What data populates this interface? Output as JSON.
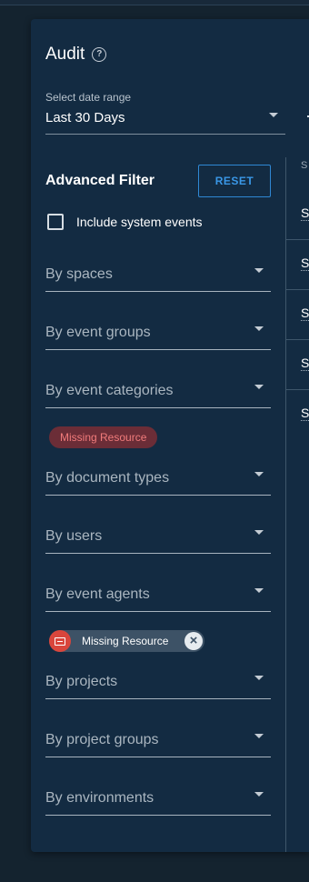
{
  "header": {
    "title": "Audit",
    "help_icon": "?"
  },
  "date_range": {
    "label": "Select date range",
    "value": "Last 30 Days"
  },
  "table": {
    "column_header": "S",
    "rows": [
      "S",
      "S",
      "S",
      "S",
      "S"
    ]
  },
  "advanced_filter": {
    "title": "Advanced Filter",
    "reset_label": "RESET",
    "include_system_events_label": "Include system events",
    "include_system_events_checked": false,
    "fields": {
      "spaces": "By spaces",
      "event_groups": "By event groups",
      "event_categories": "By event categories",
      "document_types": "By document types",
      "users": "By users",
      "event_agents": "By event agents",
      "projects": "By projects",
      "project_groups": "By project groups",
      "environments": "By environments"
    },
    "event_categories_chip": "Missing Resource",
    "event_agents_chip": "Missing Resource"
  },
  "colors": {
    "panel_bg": "#132b42",
    "accent": "#2f88d4",
    "chip_error_bg": "#6b2d37",
    "chip_error_text": "#f07b7b",
    "agent_avatar": "#d9463c"
  }
}
